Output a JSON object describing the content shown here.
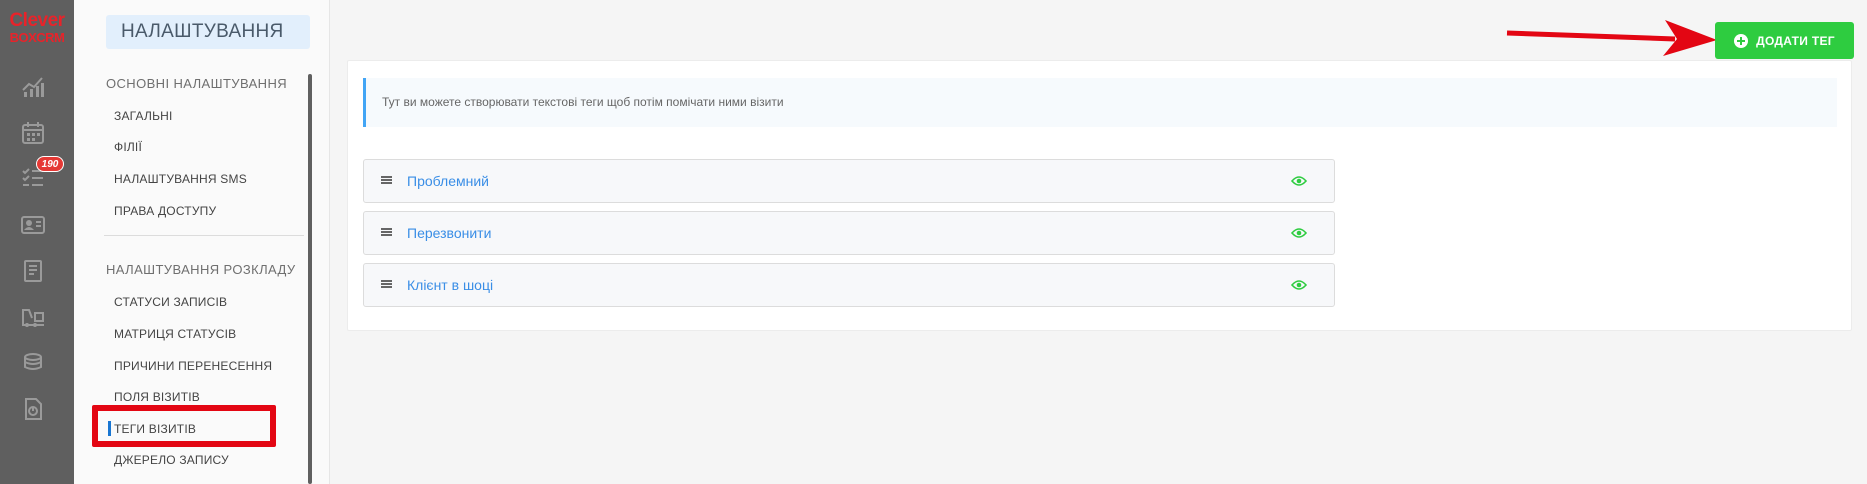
{
  "brand": {
    "line1": "Clever",
    "line2": "BOXCRM",
    "color": "#e8232a"
  },
  "rail": {
    "icons": [
      "analytics-icon",
      "calendar-icon",
      "tasks-icon",
      "contacts-icon",
      "journal-icon",
      "warehouse-icon",
      "finance-icon",
      "reports-icon"
    ],
    "badge": "190"
  },
  "sidebar": {
    "title": "НАЛАШТУВАННЯ",
    "groups": [
      {
        "title": "ОСНОВНІ НАЛАШТУВАННЯ",
        "items": [
          "ЗАГАЛЬНІ",
          "ФІЛІЇ",
          "НАЛАШТУВАННЯ SMS",
          "ПРАВА ДОСТУПУ"
        ]
      },
      {
        "title": "НАЛАШТУВАННЯ РОЗКЛАДУ",
        "items": [
          "СТАТУСИ ЗАПИСІВ",
          "МАТРИЦЯ СТАТУСІВ",
          "ПРИЧИНИ ПЕРЕНЕСЕННЯ",
          "ПОЛЯ ВІЗИТІВ",
          "ТЕГИ ВІЗИТІВ",
          "ДЖЕРЕЛО ЗАПИСУ"
        ]
      }
    ],
    "active_item": "ТЕГИ ВІЗИТІВ"
  },
  "main": {
    "add_button": "ДОДАТИ ТЕГ",
    "info_text": "Тут ви можете створювати текстові теги щоб потім помічати ними візити",
    "tags": [
      "Проблемний",
      "Перезвонити",
      "Клієнт в шоці"
    ]
  },
  "colors": {
    "accent_green": "#2ecc40",
    "annotation_red": "#e30613",
    "link_blue": "#3a8ee6"
  }
}
